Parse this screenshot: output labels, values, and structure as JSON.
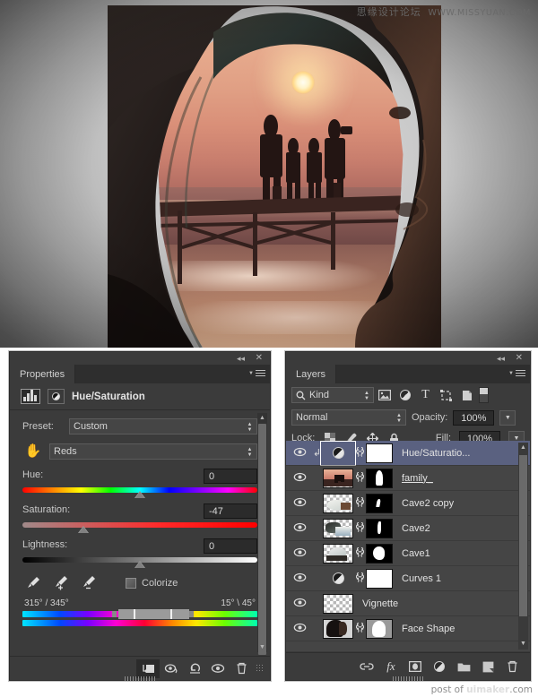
{
  "artwork": {
    "watermark_cn": "思缘设计论坛",
    "watermark_en": "WWW.MISSYUAN.COM",
    "description": "Double exposure of a woman's profile silhouette containing a sunset beach scene with a family of four on a pier"
  },
  "properties": {
    "tab_label": "Properties",
    "collapse_icon": "◂◂",
    "close_icon": "✕",
    "adjustment_title": "Hue/Saturation",
    "preset_label": "Preset:",
    "preset_value": "Custom",
    "channel_value": "Reds",
    "hand_icon": "on-image-adjust-icon",
    "hue": {
      "label": "Hue:",
      "value": "0",
      "knob_pct": 50
    },
    "saturation": {
      "label": "Saturation:",
      "value": "-47",
      "knob_pct": 26
    },
    "lightness": {
      "label": "Lightness:",
      "value": "0",
      "knob_pct": 50
    },
    "eyedroppers": [
      "eyedropper-icon",
      "eyedropper-add-icon",
      "eyedropper-subtract-icon"
    ],
    "colorize_label": "Colorize",
    "colorize_checked": false,
    "hue_range_left": "315° / 345°",
    "hue_range_right": "15° \\ 45°",
    "footer_buttons": [
      "clip-to-layer-icon",
      "view-previous-state-icon",
      "reset-icon",
      "toggle-visibility-icon",
      "delete-icon"
    ]
  },
  "layers": {
    "tab_label": "Layers",
    "collapse_icon": "◂◂",
    "close_icon": "✕",
    "filter_label": "Kind",
    "filter_icons": [
      "pixel-layer-filter-icon",
      "adjustment-layer-filter-icon",
      "type-layer-filter-icon",
      "shape-layer-filter-icon",
      "smart-object-filter-icon"
    ],
    "blend_mode": "Normal",
    "opacity_label": "Opacity:",
    "opacity_value": "100%",
    "lock_label": "Lock:",
    "lock_icons": [
      "lock-transparency-icon",
      "lock-image-icon",
      "lock-position-icon",
      "lock-all-icon"
    ],
    "fill_label": "Fill:",
    "fill_value": "100%",
    "items": [
      {
        "name": "Hue/Saturatio...",
        "selected": true,
        "type": "adjustment",
        "clipped": true,
        "has_mask": true,
        "mask": "white",
        "linked": true,
        "underline": false,
        "visible": true
      },
      {
        "name": "family_",
        "selected": false,
        "type": "pixel",
        "clipped": false,
        "has_mask": true,
        "mask": "figure",
        "linked": true,
        "underline": true,
        "visible": true
      },
      {
        "name": "Cave2 copy",
        "selected": false,
        "type": "pixel",
        "clipped": false,
        "has_mask": true,
        "mask": "small",
        "linked": true,
        "underline": false,
        "visible": true
      },
      {
        "name": "Cave2",
        "selected": false,
        "type": "pixel",
        "clipped": false,
        "has_mask": true,
        "mask": "sliver",
        "linked": true,
        "underline": false,
        "visible": true
      },
      {
        "name": "Cave1",
        "selected": false,
        "type": "pixel",
        "clipped": false,
        "has_mask": true,
        "mask": "blob",
        "linked": true,
        "underline": false,
        "visible": true
      },
      {
        "name": "Curves 1",
        "selected": false,
        "type": "adjustment",
        "clipped": false,
        "has_mask": true,
        "mask": "white",
        "linked": true,
        "underline": false,
        "visible": true
      },
      {
        "name": "Vignette",
        "selected": false,
        "type": "pixel",
        "clipped": false,
        "has_mask": false,
        "mask": "",
        "linked": false,
        "underline": false,
        "visible": true
      },
      {
        "name": "Face Shape",
        "selected": false,
        "type": "pixel",
        "clipped": false,
        "has_mask": true,
        "mask": "profile",
        "linked": true,
        "underline": false,
        "visible": true
      }
    ],
    "footer_buttons": [
      "link-layers-icon",
      "layer-style-fx-icon",
      "add-layer-mask-icon",
      "new-adjustment-layer-icon",
      "new-group-icon",
      "new-layer-icon",
      "delete-layer-icon"
    ],
    "watermark_prefix": "post of ",
    "watermark_brand": "uimaker",
    "watermark_suffix": ".com"
  }
}
